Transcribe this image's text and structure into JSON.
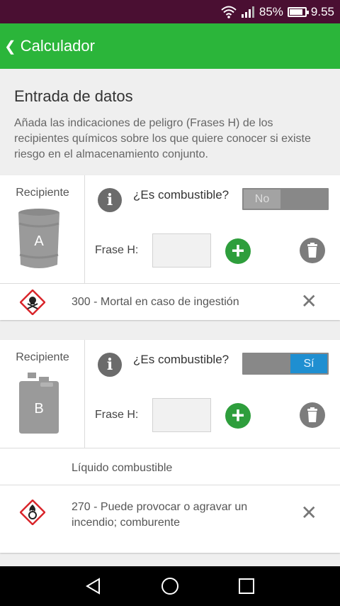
{
  "status": {
    "battery": "85%",
    "time": "9.55"
  },
  "appbar": {
    "back_glyph": "❮",
    "title": "Calculador"
  },
  "intro": {
    "title": "Entrada de datos",
    "text": "Añada las indicaciones de peligro (Frases H) de los recipientes químicos sobre los que quiere conocer si existe riesgo en el almacenamiento conjunto."
  },
  "containers": [
    {
      "label": "Recipiente",
      "letter": "A",
      "icon": "barrel-icon",
      "question": "¿Es combustible?",
      "toggle_text": "No",
      "toggle_on": false,
      "frase_label": "Frase H:",
      "frase_value": "",
      "hazards": [
        {
          "pictogram": "skull-crossbones-icon",
          "text": "300 - Mortal en caso de ingestión"
        }
      ]
    },
    {
      "label": "Recipiente",
      "letter": "B",
      "icon": "jerrycan-icon",
      "question": "¿Es combustible?",
      "toggle_text": "Sí",
      "toggle_on": true,
      "frase_label": "Frase H:",
      "frase_value": "",
      "note": "Líquido combustible",
      "hazards": [
        {
          "pictogram": "flame-over-circle-icon",
          "text": "270 - Puede provocar o agravar un incendio; comburente"
        }
      ]
    }
  ],
  "colors": {
    "appbar": "#2bb53a",
    "statusbar": "#4a0f32",
    "toggle_on": "#1f8fd1",
    "add": "#2e9e3c",
    "ghs_red": "#d9262b"
  }
}
